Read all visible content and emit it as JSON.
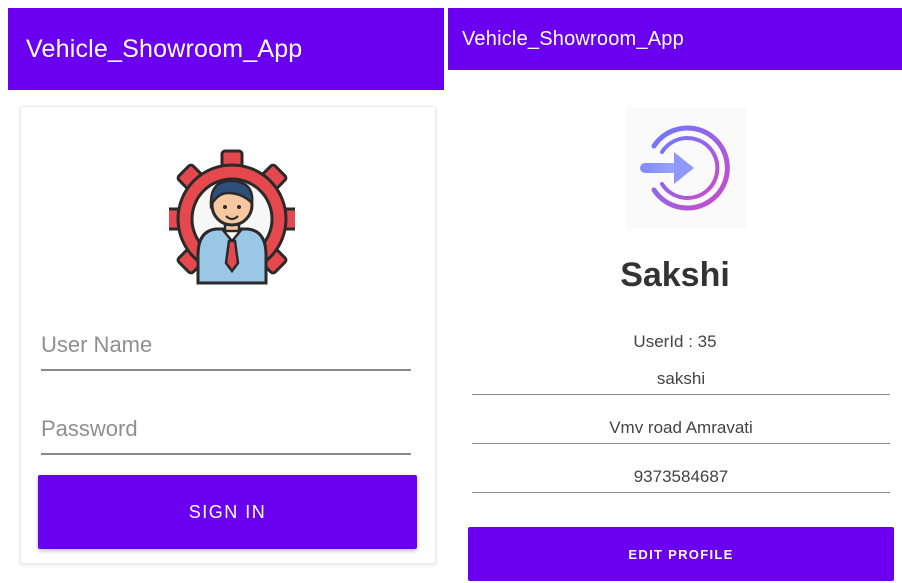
{
  "left_screen": {
    "app_bar": {
      "title": "Vehicle_Showroom_App"
    },
    "login": {
      "username_placeholder": "User Name",
      "password_placeholder": "Password",
      "signin_label": "SIGN IN",
      "avatar_icon": "user-gear-icon"
    }
  },
  "right_screen": {
    "app_bar": {
      "title": "Vehicle_Showroom_App"
    },
    "profile": {
      "icon": "login-arrow-icon",
      "name": "Sakshi",
      "userid_text": "UserId : 35",
      "username": "sakshi",
      "address": "Vmv road Amravati",
      "phone": "9373584687",
      "edit_label": "EDIT PROFILE"
    }
  },
  "colors": {
    "primary": "#6b00f0",
    "card_border": "#ececec",
    "text_dark": "#333333",
    "underline": "#8a8a8a"
  }
}
